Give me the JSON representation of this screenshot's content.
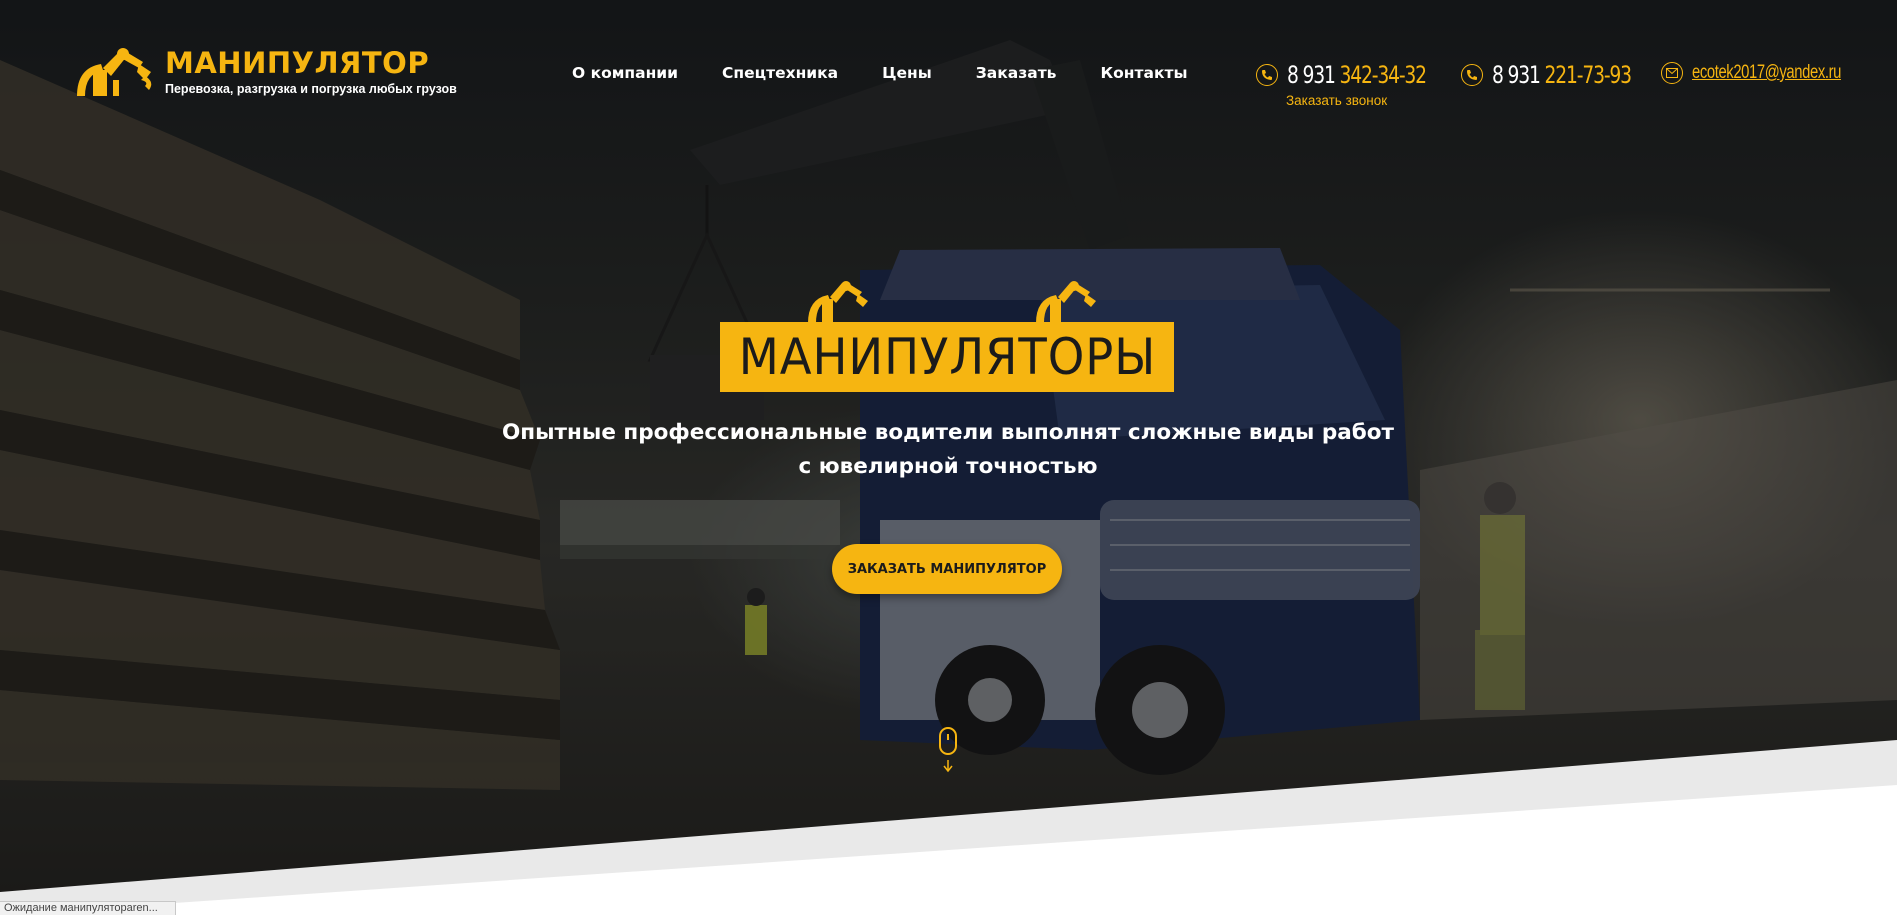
{
  "header": {
    "logo": {
      "title": "МАНИПУЛЯТОР",
      "subtitle": "Перевозка, разгрузка и погрузка любых грузов",
      "icon": "crane-manipulator-icon"
    },
    "nav": [
      "О компании",
      "Спецтехника",
      "Цены",
      "Заказать",
      "Контакты"
    ],
    "phone1": {
      "prefix": "8 931",
      "number": "342-34-32",
      "icon": "phone-icon"
    },
    "callback_label": "Заказать звонок",
    "phone2": {
      "prefix": "8 931",
      "number": "221-73-93",
      "icon": "phone-icon"
    },
    "email": {
      "address": "ecotek2017@yandex.ru",
      "icon": "mail-icon"
    }
  },
  "hero": {
    "headline": "МАНИПУЛЯТОРЫ",
    "subline_line1": "Опытные профессиональные водители выполнят сложные виды работ",
    "subline_line2": "с ювелирной точностью",
    "cta_label": "ЗАКАЗАТЬ МАНИПУЛЯТОР",
    "scroll_icon": "mouse-scroll-icon"
  },
  "status_bar": {
    "text": "Ожидание манипулятораren..."
  },
  "colors": {
    "accent": "#f6b511",
    "text_light": "#ffffff",
    "text_dark": "#1b1b1b",
    "band_grey": "#e9e9e9"
  }
}
